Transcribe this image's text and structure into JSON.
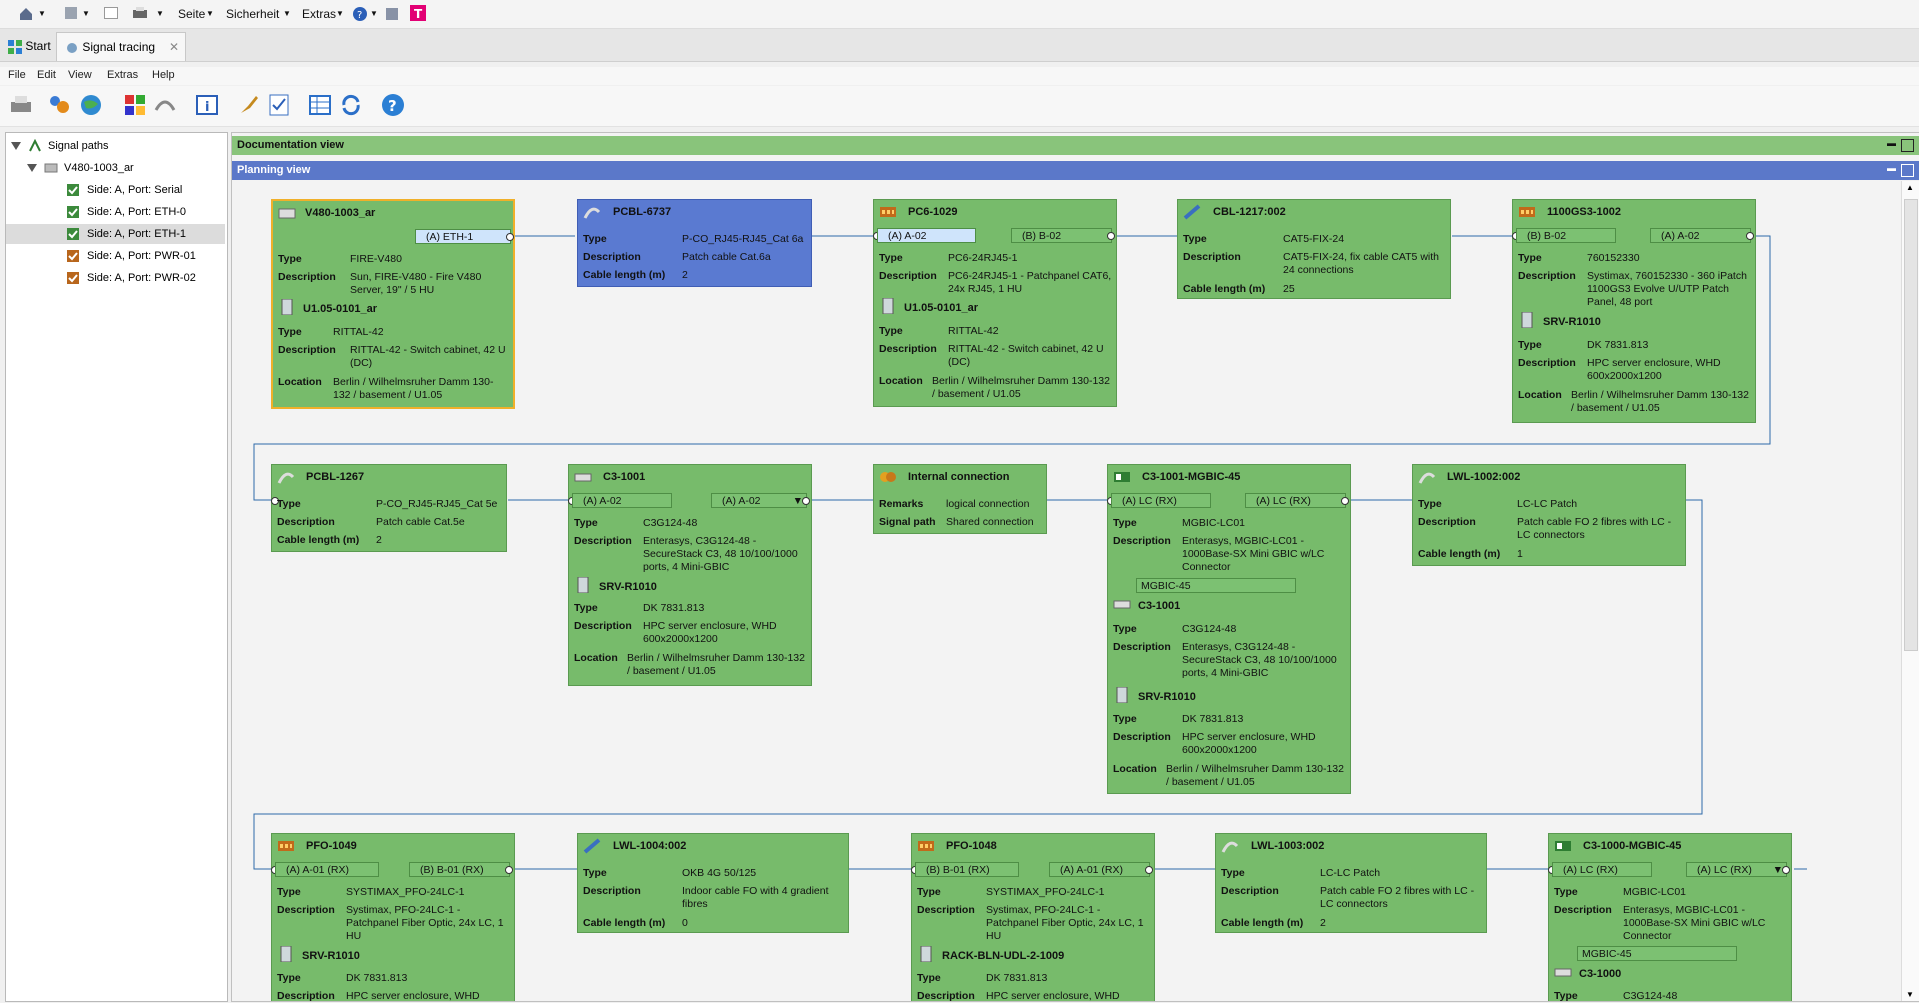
{
  "ie": {
    "seite": "Seite",
    "sicherheit": "Sicherheit",
    "extras": "Extras"
  },
  "tabs": {
    "start": "Start",
    "signal": "Signal tracing"
  },
  "menu": {
    "file": "File",
    "edit": "Edit",
    "view": "View",
    "extras": "Extras",
    "help": "Help"
  },
  "tree": {
    "root": "Signal paths",
    "device": "V480-1003_ar",
    "items": [
      "Side: A, Port: Serial",
      "Side: A, Port: ETH-0",
      "Side: A, Port: ETH-1",
      "Side: A, Port: PWR-01",
      "Side: A, Port: PWR-02"
    ]
  },
  "bars": {
    "doc": "Documentation view",
    "plan": "Planning view"
  },
  "labels": {
    "type": "Type",
    "desc": "Description",
    "loc": "Location",
    "cable": "Cable length (m)",
    "remarks": "Remarks",
    "sigpath": "Signal path"
  },
  "nodes": {
    "v480": {
      "title": "V480-1003_ar",
      "port": "(A) ETH-1",
      "type": "FIRE-V480",
      "desc": "Sun, FIRE-V480 - Fire V480 Server, 19\" / 5 HU",
      "sub": "U1.05-0101_ar",
      "sub_type": "RITTAL-42",
      "sub_desc": "RITTAL-42 - Switch cabinet, 42 U (DC)",
      "sub_loc": "Berlin / Wilhelmsruher Damm 130-132 / basement / U1.05"
    },
    "pcbl6737": {
      "title": "PCBL-6737",
      "type": "P-CO_RJ45-RJ45_Cat 6a",
      "desc": "Patch cable Cat.6a",
      "cable": "2"
    },
    "pc6": {
      "title": "PC6-1029",
      "port_a": "(A) A-02",
      "port_b": "(B) B-02",
      "type": "PC6-24RJ45-1",
      "desc": "PC6-24RJ45-1 - Patchpanel CAT6, 24x RJ45, 1 HU",
      "sub": "U1.05-0101_ar",
      "sub_type": "RITTAL-42",
      "sub_desc": "RITTAL-42 - Switch cabinet, 42 U (DC)",
      "sub_loc": "Berlin / Wilhelmsruher Damm 130-132 / basement / U1.05"
    },
    "cbl1217": {
      "title": "CBL-1217:002",
      "type": "CAT5-FIX-24",
      "desc": "CAT5-FIX-24, fix cable CAT5 with 24 connections",
      "cable": "25"
    },
    "gs1100": {
      "title": "1100GS3-1002",
      "port_b": "(B) B-02",
      "port_a": "(A) A-02",
      "type": "760152330",
      "desc": "Systimax, 760152330 - 360 iPatch 1100GS3 Evolve U/UTP Patch Panel, 48 port",
      "sub": "SRV-R1010",
      "sub_type": "DK 7831.813",
      "sub_desc": "HPC server enclosure, WHD 600x2000x1200",
      "sub_loc": "Berlin / Wilhelmsruher Damm 130-132 / basement / U1.05"
    },
    "pcbl1267": {
      "title": "PCBL-1267",
      "type": "P-CO_RJ45-RJ45_Cat 5e",
      "desc": "Patch cable Cat.5e",
      "cable": "2"
    },
    "c3": {
      "title": "C3-1001",
      "port_a": "(A) A-02",
      "port_b": "(A) A-02",
      "type": "C3G124-48",
      "desc": "Enterasys, C3G124-48 - SecureStack C3, 48 10/100/1000 ports, 4 Mini-GBIC",
      "sub": "SRV-R1010",
      "sub_type": "DK 7831.813",
      "sub_desc": "HPC server enclosure, WHD 600x2000x1200",
      "sub_loc": "Berlin / Wilhelmsruher Damm 130-132 / basement / U1.05"
    },
    "internal": {
      "title": "Internal connection",
      "remarks": "logical connection",
      "sigpath": "Shared connection"
    },
    "mgbic": {
      "title": "C3-1001-MGBIC-45",
      "port_a": "(A) LC (RX)",
      "port_b": "(A) LC (RX)",
      "type": "MGBIC-LC01",
      "desc": "Enterasys, MGBIC-LC01 - 1000Base-SX Mini GBIC w/LC Connector",
      "slot": "MGBIC-45",
      "sub1": "C3-1001",
      "sub1_type": "C3G124-48",
      "sub1_desc": "Enterasys, C3G124-48 - SecureStack C3, 48 10/100/1000 ports, 4 Mini-GBIC",
      "sub2": "SRV-R1010",
      "sub2_type": "DK 7831.813",
      "sub2_desc": "HPC server enclosure, WHD 600x2000x1200",
      "sub2_loc": "Berlin / Wilhelmsruher Damm 130-132 / basement / U1.05"
    },
    "lwl1002": {
      "title": "LWL-1002:002",
      "type": "LC-LC Patch",
      "desc": "Patch cable FO 2 fibres with LC - LC connectors",
      "cable": "1"
    },
    "pfo1049": {
      "title": "PFO-1049",
      "port_a": "(A) A-01 (RX)",
      "port_b": "(B) B-01 (RX)",
      "type": "SYSTIMAX_PFO-24LC-1",
      "desc": "Systimax, PFO-24LC-1 - Patchpanel Fiber Optic, 24x LC, 1 HU",
      "sub": "SRV-R1010",
      "sub_type": "DK 7831.813",
      "sub_desc": "HPC server enclosure, WHD"
    },
    "lwl1004": {
      "title": "LWL-1004:002",
      "type": "OKB 4G 50/125",
      "desc": "Indoor cable FO with 4 gradient fibres",
      "cable": "0"
    },
    "pfo1048": {
      "title": "PFO-1048",
      "port_b": "(B) B-01 (RX)",
      "port_a": "(A) A-01 (RX)",
      "type": "SYSTIMAX_PFO-24LC-1",
      "desc": "Systimax, PFO-24LC-1 - Patchpanel Fiber Optic, 24x LC, 1 HU",
      "sub": "RACK-BLN-UDL-2-1009",
      "sub_type": "DK 7831.813",
      "sub_desc": "HPC server enclosure, WHD"
    },
    "lwl1003": {
      "title": "LWL-1003:002",
      "type": "LC-LC Patch",
      "desc": "Patch cable FO 2 fibres with LC - LC connectors",
      "cable": "2"
    },
    "c3mgbic": {
      "title": "C3-1000-MGBIC-45",
      "port_a": "(A) LC (RX)",
      "port_b": "(A) LC (RX)",
      "type": "MGBIC-LC01",
      "desc": "Enterasys, MGBIC-LC01 - 1000Base-SX Mini GBIC w/LC Connector",
      "slot": "MGBIC-45",
      "sub": "C3-1000",
      "sub_type": "C3G124-48"
    }
  }
}
